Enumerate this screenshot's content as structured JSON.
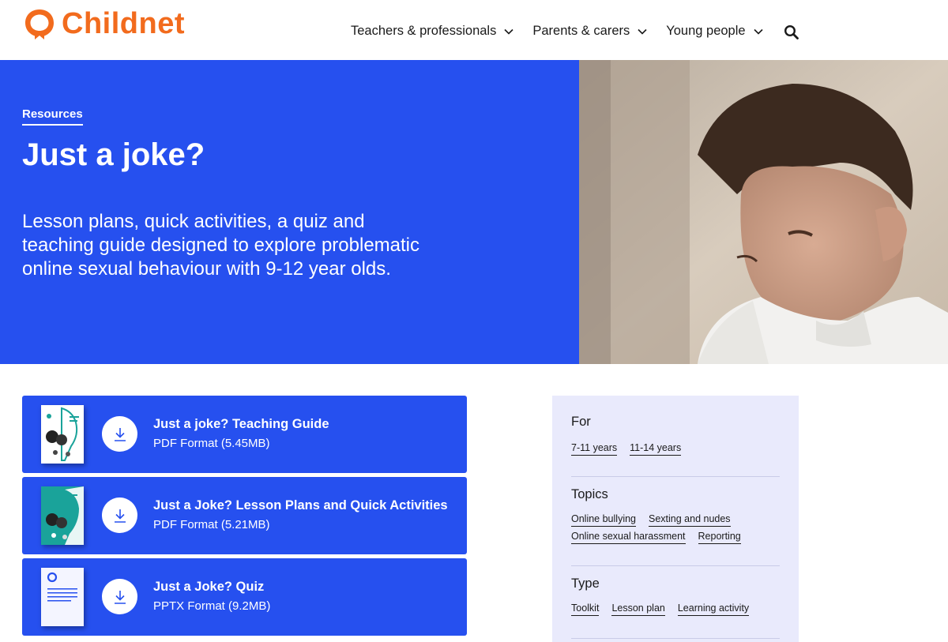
{
  "brand": {
    "name": "Childnet",
    "color": "#f26b1d"
  },
  "nav": {
    "items": [
      {
        "label": "Teachers & professionals"
      },
      {
        "label": "Parents & carers"
      },
      {
        "label": "Young people"
      }
    ],
    "search_icon": "search-icon"
  },
  "hero": {
    "breadcrumb": "Resources",
    "title": "Just a joke?",
    "description": "Lesson plans, quick activities, a quiz and teaching guide designed to explore problematic online sexual behaviour with 9-12 year olds.",
    "background": "#2650ef"
  },
  "downloads": [
    {
      "title": "Just a joke? Teaching Guide",
      "format": "PDF Format (5.45MB)",
      "icon": "download-icon"
    },
    {
      "title": "Just a Joke? Lesson Plans and Quick Activities",
      "format": "PDF Format (5.21MB)",
      "icon": "download-icon"
    },
    {
      "title": "Just a Joke? Quiz",
      "format": "PPTX Format (9.2MB)",
      "icon": "download-icon"
    }
  ],
  "sidebar": {
    "for": {
      "heading": "For",
      "tags": [
        "7-11 years",
        "11-14 years"
      ]
    },
    "topics": {
      "heading": "Topics",
      "tags": [
        "Online bullying",
        "Sexting and nudes",
        "Online sexual harassment",
        "Reporting"
      ]
    },
    "type": {
      "heading": "Type",
      "tags": [
        "Toolkit",
        "Lesson plan",
        "Learning activity"
      ]
    }
  }
}
